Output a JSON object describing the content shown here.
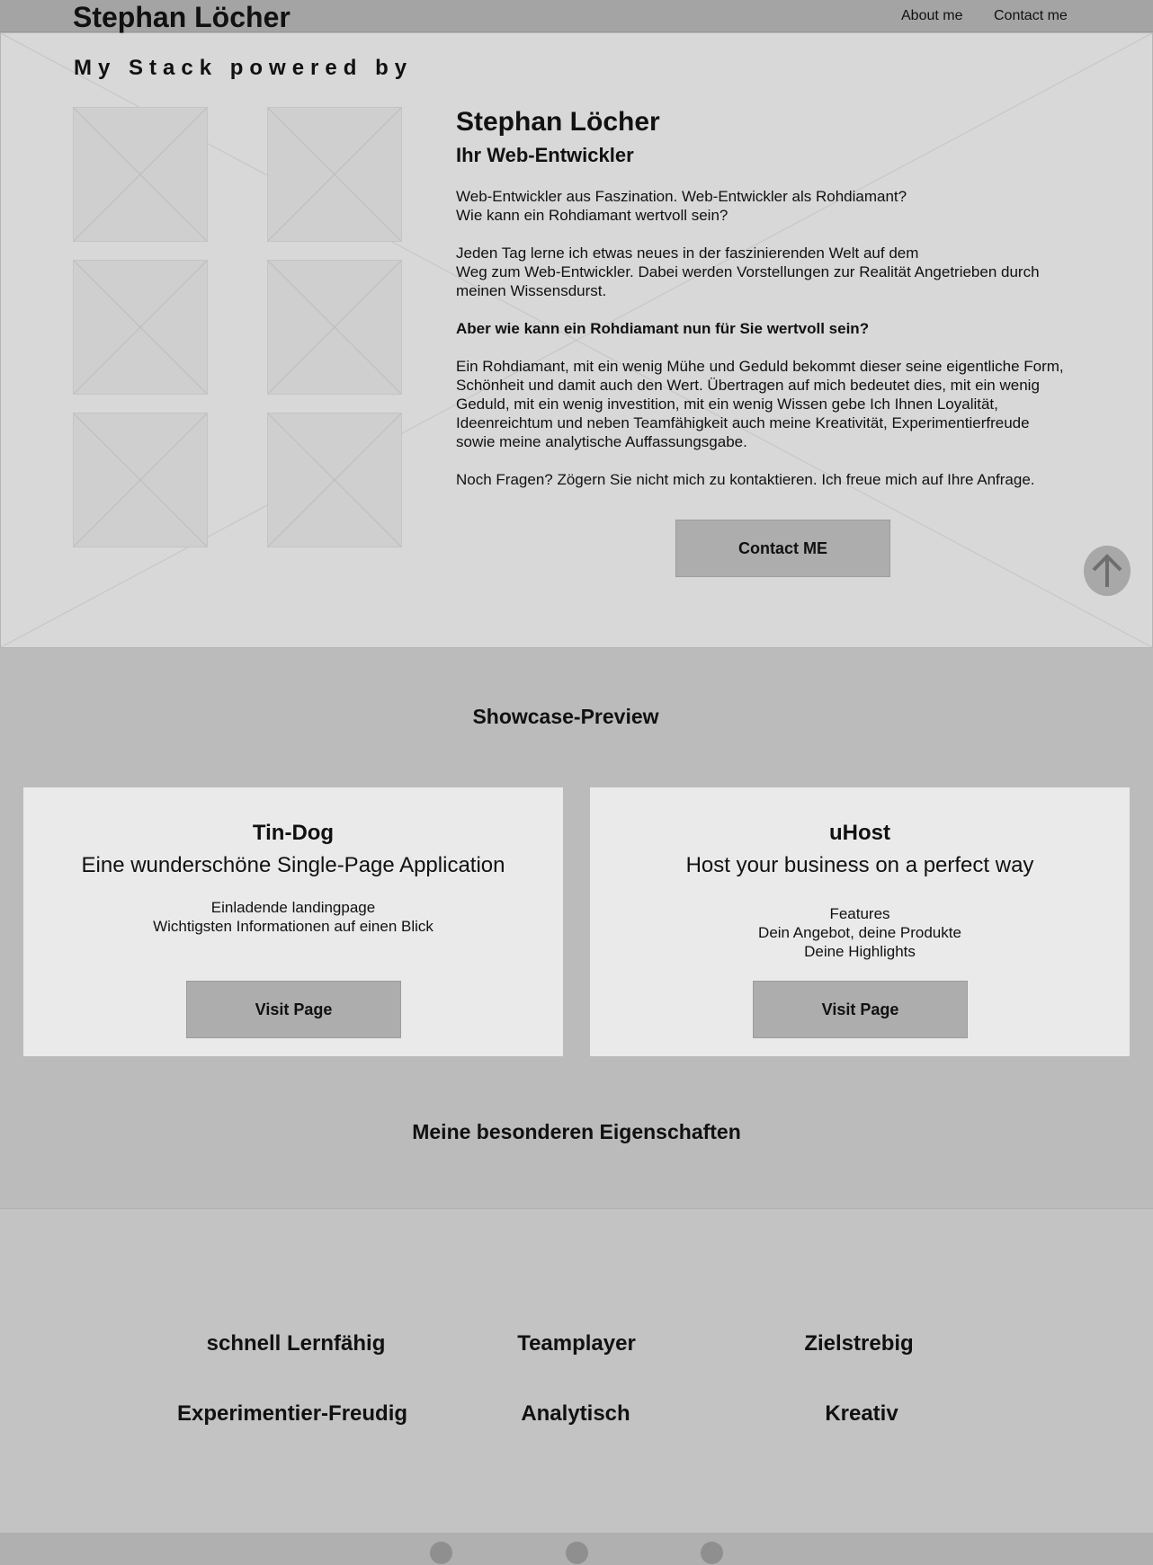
{
  "header": {
    "brand": "Stephan Löcher",
    "nav": [
      "About me",
      "Contact me"
    ]
  },
  "hero": {
    "stack_title": "My Stack powered by",
    "name": "Stephan Löcher",
    "role": "Ihr Web-Entwickler",
    "para1": [
      "Web-Entwickler aus Faszination. Web-Entwickler als Rohdiamant?",
      "Wie kann ein Rohdiamant wertvoll sein?"
    ],
    "para2": [
      "Jeden Tag lerne ich etwas neues in der faszinierenden Welt auf dem",
      "Weg zum Web-Entwickler. Dabei werden Vorstellungen zur Realität  Angetrieben durch",
      "meinen Wissensdurst."
    ],
    "question": "Aber wie kann ein Rohdiamant nun für Sie wertvoll sein?",
    "para3": [
      "Ein Rohdiamant, mit ein wenig Mühe und Geduld bekommt dieser seine eigentliche Form,",
      "Schönheit und damit auch den Wert. Übertragen auf mich bedeutet dies, mit ein wenig",
      "Geduld, mit ein wenig investition, mit ein wenig Wissen gebe Ich Ihnen Loyalität,",
      "Ideenreichtum und neben Teamfähigkeit auch meine Kreativität, Experimentierfreude",
      "sowie meine analytische Auffassungsgabe."
    ],
    "para4": "Noch Fragen? Zögern Sie nicht mich zu kontaktieren. Ich freue mich auf Ihre Anfrage.",
    "contact_button": "Contact ME",
    "scroll_up_icon": "arrow-up-icon"
  },
  "showcase": {
    "title": "Showcase-Preview",
    "cards": [
      {
        "name": "Tin-Dog",
        "subtitle": "Eine wunderschöne Single-Page Application",
        "desc": [
          "Einladende landingpage",
          "Wichtigsten Informationen auf einen Blick"
        ],
        "button": "Visit Page"
      },
      {
        "name": "uHost",
        "subtitle": "Host your business on a perfect way",
        "desc": [
          "Features",
          "Dein Angebot, deine Produkte",
          "Deine Highlights"
        ],
        "button": "Visit Page"
      }
    ]
  },
  "traits": {
    "title": "Meine besonderen Eigenschaften",
    "items": [
      "schnell Lernfähig",
      "Teamplayer",
      "Zielstrebig",
      "Experimentier-Freudig",
      "Analytisch",
      "Kreativ"
    ]
  },
  "colors": {
    "header_bg": "#a5a4a4",
    "hero_bg": "#d8d8d8",
    "section_bg": "#bbbbbb",
    "card_bg": "#eaeaea",
    "button_bg": "#adadad",
    "traits_bg": "#c3c3c3",
    "footer_bg": "#b0b0b0"
  }
}
